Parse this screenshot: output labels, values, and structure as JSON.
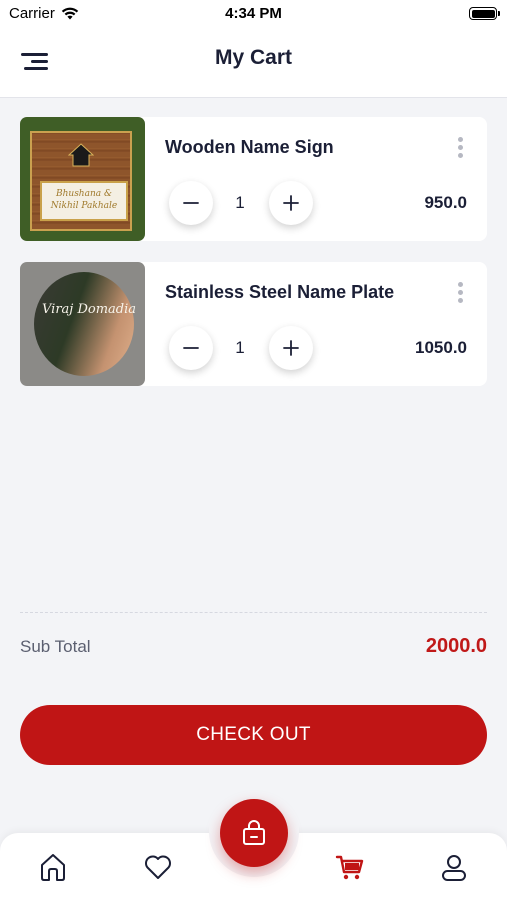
{
  "status_bar": {
    "carrier": "Carrier",
    "time": "4:34 PM"
  },
  "header": {
    "title": "My Cart"
  },
  "cart": {
    "items": [
      {
        "name": "Wooden Name Sign",
        "quantity": "1",
        "price": "950.0",
        "thumb_text": "Bhushana & Nikhil Pakhale"
      },
      {
        "name": "Stainless Steel Name Plate",
        "quantity": "1",
        "price": "1050.0",
        "thumb_text": "Viraj Domadia"
      }
    ]
  },
  "summary": {
    "subtotal_label": "Sub Total",
    "subtotal_value": "2000.0"
  },
  "checkout": {
    "label": "CHECK OUT"
  },
  "nav": {
    "items": [
      {
        "icon": "home-icon"
      },
      {
        "icon": "heart-icon"
      },
      {
        "icon": "shopping-bag-icon"
      },
      {
        "icon": "cart-icon",
        "active": true
      },
      {
        "icon": "user-icon"
      }
    ]
  },
  "colors": {
    "accent": "#c01515",
    "text": "#1b1f36",
    "background": "#f3f4f7"
  }
}
